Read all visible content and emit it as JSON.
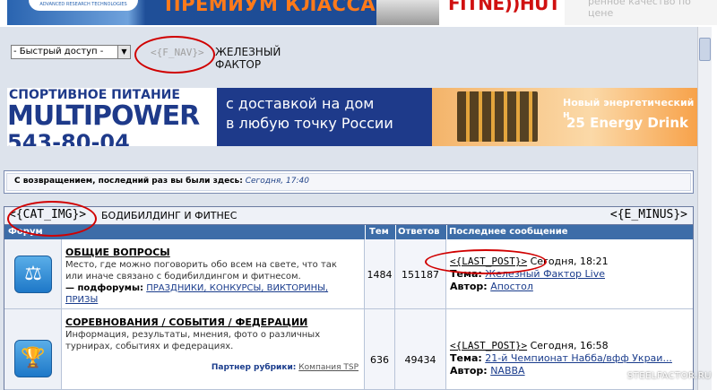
{
  "top_banners": {
    "banner1_text": "ПРЕМИУМ КЛАССА",
    "banner1_logo_text": "ADVANCED RESEARCH TECHNOLOGIES",
    "banner2_text": "FITNE))HUT",
    "banner3_text": "ренное качество по цене"
  },
  "nav": {
    "quick_access_label": "- Быстрый доступ -",
    "fnav_placeholder": "<{F_NAV}>",
    "site_title": "ЖЕЛЕЗНЫЙ ФАКТОР"
  },
  "ad_banner": {
    "left_line1": "СПОРТИВНОЕ ПИТАНИЕ",
    "left_line2": "MULTIPOWER",
    "left_line3": "543-80-04",
    "middle_line1": "с доставкой на дом",
    "middle_line2": "в любую точку России",
    "right_line1": "Новый энергетический н",
    "right_line2": "25 Energy Drink"
  },
  "welcome": {
    "text": "С возвращением, последний раз вы были здесь:",
    "time": "Сегодня, 17:40"
  },
  "category": {
    "img_placeholder": "<{CAT_IMG}>",
    "title": "БОДИБИЛДИНГ И ФИТНЕС",
    "eminus_placeholder": "<{E_MINUS}>"
  },
  "columns": {
    "forum": "Форум",
    "topics": "Тем",
    "replies": "Ответов",
    "last_post": "Последнее сообщение"
  },
  "forums": [
    {
      "title": "ОБЩИЕ ВОПРОСЫ",
      "desc_line1": "Место, где можно поговорить обо всем на свете, что так",
      "desc_line2": "или иначе связано с бодибилдингом и фитнесом.",
      "subforums_label": "— подфорумы:",
      "subforums": "ПРАЗДНИКИ, КОНКУРСЫ, ВИКТОРИНЫ,",
      "subforums_cont": "ПРИЗЫ",
      "topics": "1484",
      "replies": "151187",
      "last_tag": "<{LAST_POST}>",
      "last_time": "Сегодня, 18:21",
      "theme_label": "Тема:",
      "theme": "Железный Фактор Live",
      "author_label": "Автор:",
      "author": "Апостол"
    },
    {
      "title": "СОРЕВНОВАНИЯ / СОБЫТИЯ / ФЕДЕРАЦИИ",
      "desc_line1": "Информация, результаты, мнения, фото о различных",
      "desc_line2": "турнирах, событиях и федерациях.",
      "partner_label": "Партнер рубрики:",
      "partner": "Компания TSP",
      "topics": "636",
      "replies": "49434",
      "last_tag": "<{LAST_POST}>",
      "last_time": "Сегодня, 16:58",
      "theme_label": "Тема:",
      "theme": "21-й Чемпионат Набба/вфф Украи...",
      "author_label": "Автор:",
      "author": "NABBA"
    }
  ],
  "watermark": "STEELFACTOR.RU",
  "colors": {
    "header_blue": "#3d6da8",
    "annotation_red": "#d00000",
    "link_blue": "#1a3c8c"
  }
}
